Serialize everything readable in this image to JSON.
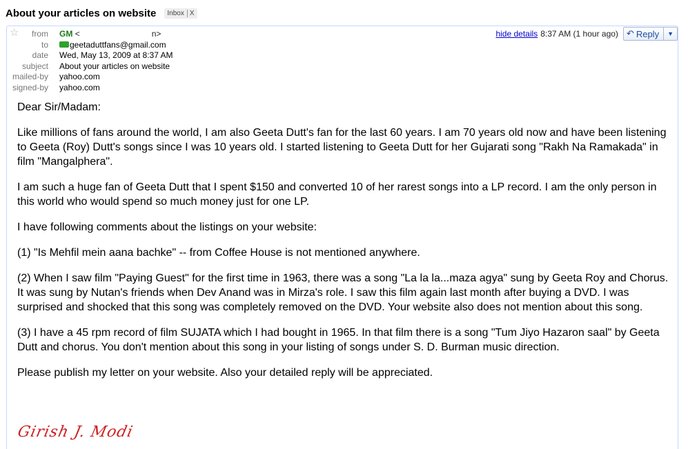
{
  "thread": {
    "subject": "About your articles on website",
    "label_chip": "Inbox",
    "label_chip_close": "X"
  },
  "header": {
    "from_label": "from",
    "from_name": "GM",
    "from_email_open": "<",
    "from_email_close": "n>",
    "to_label": "to",
    "to_value": "geetaduttfans@gmail.com",
    "date_label": "date",
    "date_value": "Wed, May 13, 2009 at 8:37 AM",
    "subject_label": "subject",
    "subject_value": "About your articles on website",
    "mailed_by_label": "mailed-by",
    "mailed_by_value": "yahoo.com",
    "signed_by_label": "signed-by",
    "signed_by_value": "yahoo.com",
    "hide_details": "hide details",
    "time": "8:37 AM (1 hour ago)",
    "reply_label": "Reply",
    "reply_icon": "reply-arrow-icon",
    "menu_icon": "triangle-down-icon",
    "presence_color": "#2fa12f"
  },
  "body": {
    "greeting": "Dear Sir/Madam:",
    "p1": "Like millions of fans around the world, I am also Geeta Dutt's fan for the last 60 years. I am 70 years old now and have been listening to Geeta (Roy) Dutt's songs since I was 10 years old. I started listening to Geeta Dutt for her Gujarati song  \"Rakh Na Ramakada\" in film \"Mangalphera\".",
    "p2": "I am such a huge fan of Geeta Dutt that I spent $150 and converted 10 of her rarest songs into a LP record. I am the only person in this world who would spend so much money just for one LP.",
    "p3": "I have following comments about the listings on your website:",
    "p4": "(1) \"Is Mehfil mein aana bachke\" -- from Coffee House is not mentioned anywhere.",
    "p5": "(2) When I saw film \"Paying Guest\" for the first time in 1963, there was a song \"La la la...maza agya\" sung by Geeta Roy and Chorus. It was sung by Nutan's friends when Dev Anand was in Mirza's role. I saw this film again last month after buying a DVD. I was surprised and shocked that this song was completely removed on the DVD. Your website also does not mention about this song.",
    "p6": "(3) I have a 45 rpm record of film SUJATA which I had bought in 1965. In that film there is a song \"Tum Jiyo Hazaron saal\" by Geeta Dutt and chorus. You don't mention about this song in your listing of songs under S. D. Burman music direction.",
    "p7": "Please publish my letter on your website. Also your detailed reply will be appreciated.",
    "signature": "Girish J. Modi",
    "signature_color": "#cc2222"
  }
}
